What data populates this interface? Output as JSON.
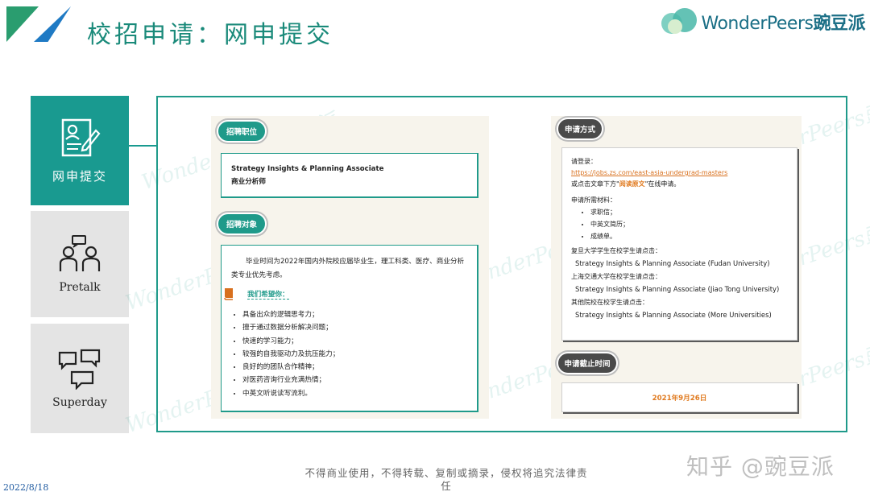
{
  "header": {
    "title": "校招申请：网申提交",
    "logo_text": "WonderPeers",
    "logo_cn": "豌豆派"
  },
  "nav": [
    {
      "label": "网申提交",
      "active": true,
      "icon": "form-edit-icon"
    },
    {
      "label": "Pretalk",
      "active": false,
      "icon": "people-talk-icon"
    },
    {
      "label": "Superday",
      "active": false,
      "icon": "chat-bubbles-icon"
    }
  ],
  "left": {
    "position_pill": "招聘职位",
    "position_line1": "Strategy Insights & Planning Associate",
    "position_line2": "商业分析师",
    "target_pill": "招聘对象",
    "target_text": "毕业时间为2022年国内外院校应届毕业生，理工科类、医疗、商业分析类专业优先考虑。",
    "hope_label": "我们希望你：",
    "requirements": [
      "具备出众的逻辑思考力；",
      "擅于通过数据分析解决问题；",
      "快速的学习能力；",
      "较强的自我驱动力及抗压能力；",
      "良好的的团队合作精神；",
      "对医药咨询行业充满热情；",
      "中英文听说读写流利。"
    ]
  },
  "right": {
    "method_pill": "申请方式",
    "login_label": "请登录：",
    "url": "https://jobs.zs.com/east-asia-undergrad-masters",
    "or_prefix": "或点击文章下方\"",
    "or_link": "阅读原文",
    "or_suffix": "\"在线申请。",
    "materials_label": "申请所需材料：",
    "materials": [
      "求职信；",
      "中英文简历；",
      "成绩单。"
    ],
    "fudan_label": "复旦大学学生在校学生请点击：",
    "fudan_link": "Strategy Insights & Planning Associate (Fudan University)",
    "sjtu_label": "上海交通大学在校学生请点击：",
    "sjtu_link": "Strategy Insights & Planning Associate (Jiao Tong University)",
    "other_label": "其他院校在校学生请点击：",
    "other_link": "Strategy Insights & Planning Associate (More Universities)",
    "deadline_pill": "申请截止时间",
    "deadline": "2021年9月26日"
  },
  "footer": {
    "notice": "不得商业使用，不得转载、复制或摘录，侵权将追究法律责任",
    "date": "2022/8/18",
    "zhihu": "知乎 @豌豆派"
  },
  "watermark": "WonderPeers豌豆派",
  "colors": {
    "teal": "#1f9a8a",
    "nav_active": "#199a90",
    "title": "#1a8a7a",
    "accent_orange": "#e07a1f",
    "dark_pill": "#4a4a4a"
  }
}
